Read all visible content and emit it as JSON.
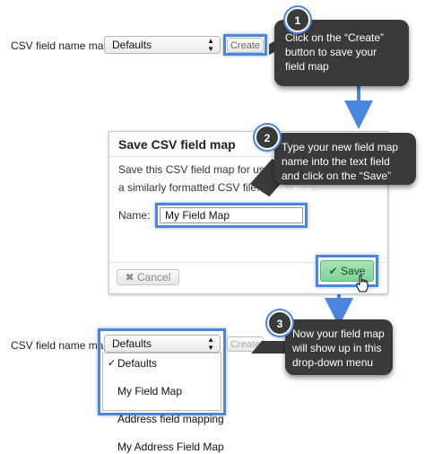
{
  "top": {
    "field_label": "CSV field name map:",
    "selected": "Defaults",
    "create_label": "Create"
  },
  "callouts": [
    {
      "number": "1",
      "text": "Click on the “Create” button to save your field map"
    },
    {
      "number": "2",
      "text": "Type your new field map name into the text field and click on the “Save” button"
    },
    {
      "number": "3",
      "text": "Now your field map will show up in this drop-down menu"
    }
  ],
  "dialog": {
    "title": "Save CSV field map",
    "line1": "Save this CSV field map for use th",
    "line2": "a similarly formatted CSV file.",
    "name_label": "Name:",
    "name_value": "My Field Map",
    "cancel_label": "Cancel",
    "save_label": "Save"
  },
  "bottom": {
    "field_label": "CSV field name map:",
    "selected": "Defaults",
    "create_label": "Create",
    "options": [
      "Defaults",
      "My Field Map",
      "Address field mapping",
      "My Address Field Map"
    ]
  },
  "colors": {
    "highlight": "#4a86e0",
    "callout": "#3a3a3a",
    "save": "#7fd297"
  }
}
